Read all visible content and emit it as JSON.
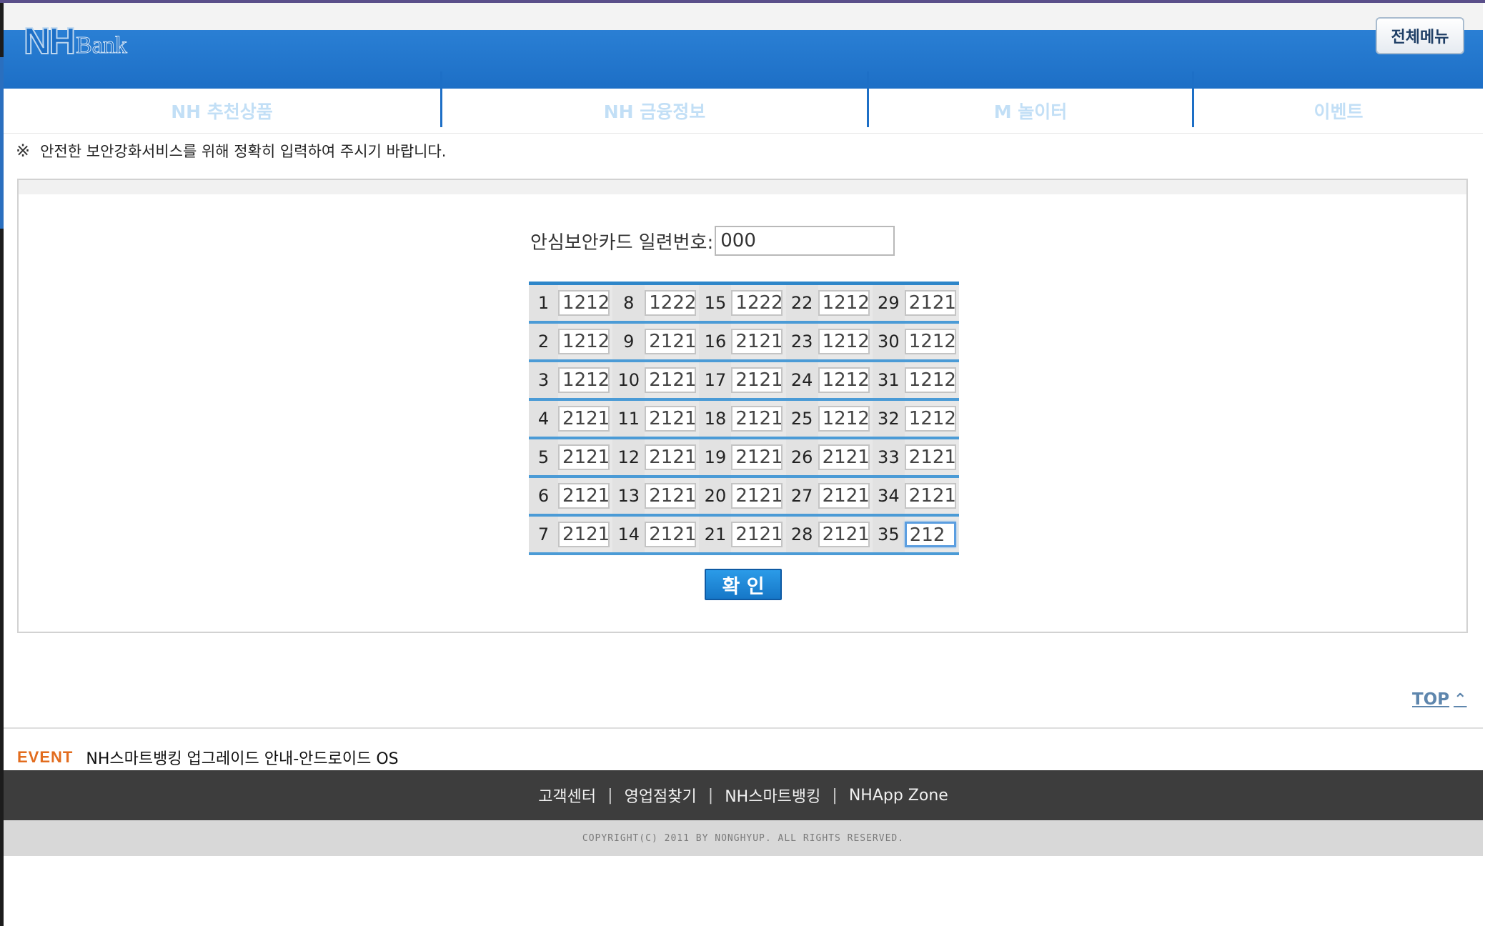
{
  "header": {
    "logo_nh": "NH",
    "logo_bank": "Bank",
    "menu_button": "전체메뉴"
  },
  "nav": {
    "tabs": [
      "NH 추천상품",
      "NH 금융정보",
      "M 놀이터",
      "이벤트"
    ]
  },
  "notice": {
    "mark": "※",
    "text": "안전한 보안강화서비스를 위해 정확히 입력하여 주시기 바랍니다."
  },
  "form": {
    "serial_label": "안심보안카드 일련번호:",
    "serial_value": "000",
    "grid": [
      [
        "1",
        "1212",
        "8",
        "1222",
        "15",
        "1222",
        "22",
        "1212",
        "29",
        "2121"
      ],
      [
        "2",
        "1212",
        "9",
        "2121",
        "16",
        "2121",
        "23",
        "1212",
        "30",
        "1212"
      ],
      [
        "3",
        "1212",
        "10",
        "2121",
        "17",
        "2121",
        "24",
        "1212",
        "31",
        "1212"
      ],
      [
        "4",
        "2121",
        "11",
        "2121",
        "18",
        "2121",
        "25",
        "1212",
        "32",
        "1212"
      ],
      [
        "5",
        "2121",
        "12",
        "2121",
        "19",
        "2121",
        "26",
        "2121",
        "33",
        "2121"
      ],
      [
        "6",
        "2121",
        "13",
        "2121",
        "20",
        "2121",
        "27",
        "2121",
        "34",
        "2121"
      ],
      [
        "7",
        "2121",
        "14",
        "2121",
        "21",
        "2121",
        "28",
        "2121",
        "35",
        "212"
      ]
    ],
    "confirm_button": "확 인"
  },
  "top_link": {
    "label": "TOP",
    "icon": "double-chevron-up-icon"
  },
  "event": {
    "tag": "EVENT",
    "text": "NH스마트뱅킹 업그레이드 안내-안드로이드 OS"
  },
  "footer": {
    "links": [
      "고객센터",
      "영업점찾기",
      "NH스마트뱅킹",
      "NHApp Zone"
    ],
    "separator": "|",
    "copyright": "COPYRIGHT(C) 2011 BY NONGHYUP. ALL RIGHTS RESERVED."
  },
  "colors": {
    "brand_blue": "#1d6fc6",
    "event_orange": "#e26c1e",
    "footer_dark": "#3d3d3d"
  }
}
